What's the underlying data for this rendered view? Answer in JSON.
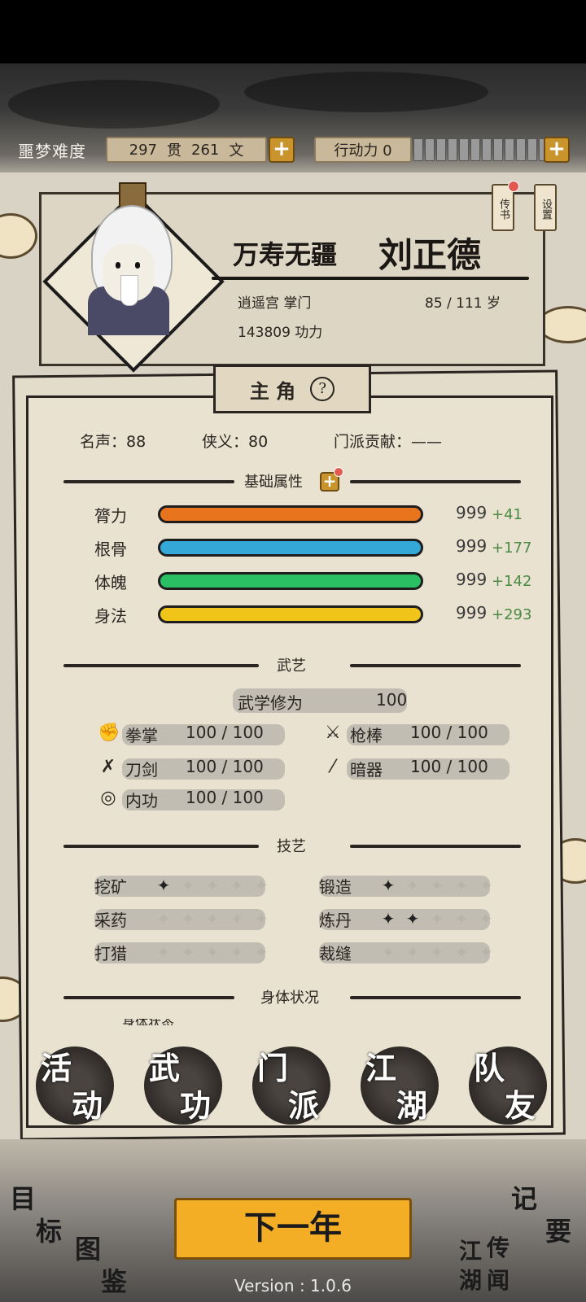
{
  "header": {
    "difficulty": "噩梦难度",
    "money_guan": "297",
    "money_guan_unit": "贯",
    "money_wen": "261",
    "money_wen_unit": "文",
    "action_points_label": "行动力 0",
    "action_points_value": 0,
    "action_points_max_segments": 12
  },
  "character": {
    "title": "万寿无疆",
    "name": "刘正德",
    "sect_role": "逍遥宫 掌门",
    "age": "85 / 111 岁",
    "power": "143809 功力",
    "news_tag": "传书",
    "settings_tag": "设置"
  },
  "panel": {
    "tab_title": "主 角",
    "help_icon": "?",
    "fame_label": "名声：88",
    "chivalry_label": "侠义：80",
    "sect_contribution_label": "门派贡献：——",
    "basic_attr_title": "基础属性",
    "attributes": [
      {
        "label": "膂力",
        "value": "999",
        "bonus": "+41",
        "color": "#e8741e"
      },
      {
        "label": "根骨",
        "value": "999",
        "bonus": "+177",
        "color": "#34a8d6"
      },
      {
        "label": "体魄",
        "value": "999",
        "bonus": "+142",
        "color": "#2bbf63"
      },
      {
        "label": "身法",
        "value": "999",
        "bonus": "+293",
        "color": "#f0c419"
      }
    ],
    "martial_title": "武艺",
    "martial_cultivation_label": "武学修为",
    "martial_cultivation_value": "100",
    "martial_skills": [
      {
        "label": "拳掌",
        "value": "100 / 100",
        "icon": "fist-icon"
      },
      {
        "label": "枪棒",
        "value": "100 / 100",
        "icon": "spear-icon"
      },
      {
        "label": "刀剑",
        "value": "100 / 100",
        "icon": "swords-icon"
      },
      {
        "label": "暗器",
        "value": "100 / 100",
        "icon": "dart-icon"
      },
      {
        "label": "内功",
        "value": "100 / 100",
        "icon": "energy-icon"
      }
    ],
    "crafts_title": "技艺",
    "crafts": [
      {
        "label": "挖矿",
        "level": 1
      },
      {
        "label": "锻造",
        "level": 1
      },
      {
        "label": "采药",
        "level": 0
      },
      {
        "label": "炼丹",
        "level": 2
      },
      {
        "label": "打猎",
        "level": 0
      },
      {
        "label": "裁缝",
        "level": 0
      }
    ],
    "body_title": "身体状况",
    "body_cutoff_text": "身体状态"
  },
  "nav": [
    {
      "top": "活",
      "bottom": "动"
    },
    {
      "top": "武",
      "bottom": "功"
    },
    {
      "top": "门",
      "bottom": "派"
    },
    {
      "top": "江",
      "bottom": "湖"
    },
    {
      "top": "队",
      "bottom": "友"
    }
  ],
  "bottom": {
    "goal_top": "目",
    "goal_bottom": "标",
    "atlas_top": "图",
    "atlas_bottom": "鉴",
    "notes_top": "记",
    "notes_bottom": "要",
    "rumors_a": "江",
    "rumors_b": "湖",
    "rumors_c": "传",
    "rumors_d": "闻",
    "next_year": "下一年",
    "version": "Version : 1.0.6"
  }
}
